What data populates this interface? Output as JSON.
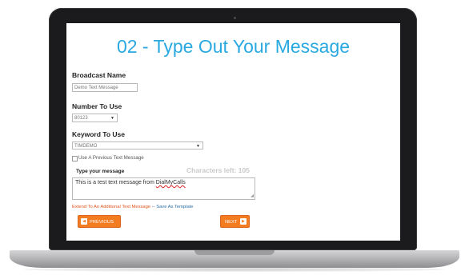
{
  "page": {
    "title": "02 - Type Out Your Message"
  },
  "broadcast_name": {
    "label": "Broadcast Name",
    "value": "Demo Text Message"
  },
  "number_to_use": {
    "label": "Number To Use",
    "selected": "80123"
  },
  "keyword_to_use": {
    "label": "Keyword To Use",
    "selected": "TIMDEMO"
  },
  "previous_message": {
    "label": "Use A Previous Text Message",
    "checked": false
  },
  "message": {
    "label": "Type your message",
    "characters_left": "Characters left: 105",
    "text_before": "This is a test text message from ",
    "text_word": "DialMyCalls"
  },
  "links": {
    "extend": "Extend To An Additional Text Message",
    "separator": "--",
    "save_template": "Save As Template"
  },
  "buttons": {
    "previous": "PREVIOUS",
    "next": "NEXT"
  },
  "icons": {
    "select_arrow": "chevron-down-icon",
    "prev_arrow": "chevron-left-icon",
    "next_arrow": "chevron-right-icon"
  },
  "colors": {
    "title": "#29a9e0",
    "button": "#f47c20",
    "link_orange": "#e2541e",
    "link_blue": "#2a6ea8",
    "chars_left": "#c9c9c9"
  }
}
